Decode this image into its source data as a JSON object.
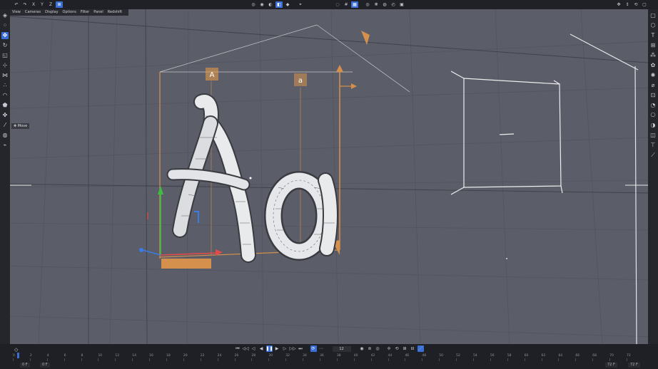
{
  "toolbar": {
    "left_buttons": [
      "↶",
      "↷",
      "X",
      "Y",
      "Z",
      "⊞"
    ],
    "center_buttons": [
      "◎",
      "◉",
      "◐",
      "◧",
      "◆",
      "⌖",
      "◌"
    ],
    "right_buttons": [
      "#",
      "▦",
      "◎",
      "❋",
      "◍",
      "◴",
      "▣"
    ]
  },
  "viewport": {
    "menu": [
      "View",
      "Cameras",
      "Display",
      "Options",
      "Filter",
      "Panel",
      "Redshift"
    ],
    "hud_tool": "Move",
    "text_object": "Ao",
    "glyph_label_a": "A",
    "glyph_label_o": "a"
  },
  "timeline": {
    "current_frame": "12",
    "ruler_labels": [
      "0",
      "2",
      "4",
      "6",
      "8",
      "10",
      "12",
      "14",
      "16",
      "18",
      "20",
      "22",
      "24",
      "26",
      "28",
      "30",
      "32",
      "34",
      "36",
      "38",
      "40",
      "42",
      "44",
      "46",
      "48",
      "50",
      "52",
      "54",
      "56",
      "58",
      "60",
      "62",
      "64",
      "66",
      "68",
      "70",
      "72"
    ],
    "start_field": "0 F",
    "start_field2": "0 F",
    "end_field": "72 F",
    "end_field2": "72 F"
  },
  "colors": {
    "viewport_bg": "#5b5d69",
    "accent": "#3b6fd6",
    "selection_orange": "#e39a4a"
  }
}
